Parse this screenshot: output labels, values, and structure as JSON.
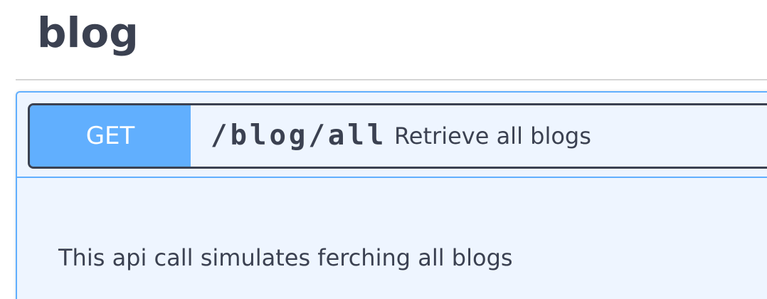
{
  "tag": {
    "name": "blog"
  },
  "operation": {
    "method": "GET",
    "path": "/blog/all",
    "summary": "Retrieve all blogs",
    "description": "This api call simulates ferching all blogs"
  },
  "colors": {
    "get_accent": "#61affe",
    "get_background": "#eef5ff",
    "text": "#3b4151"
  }
}
